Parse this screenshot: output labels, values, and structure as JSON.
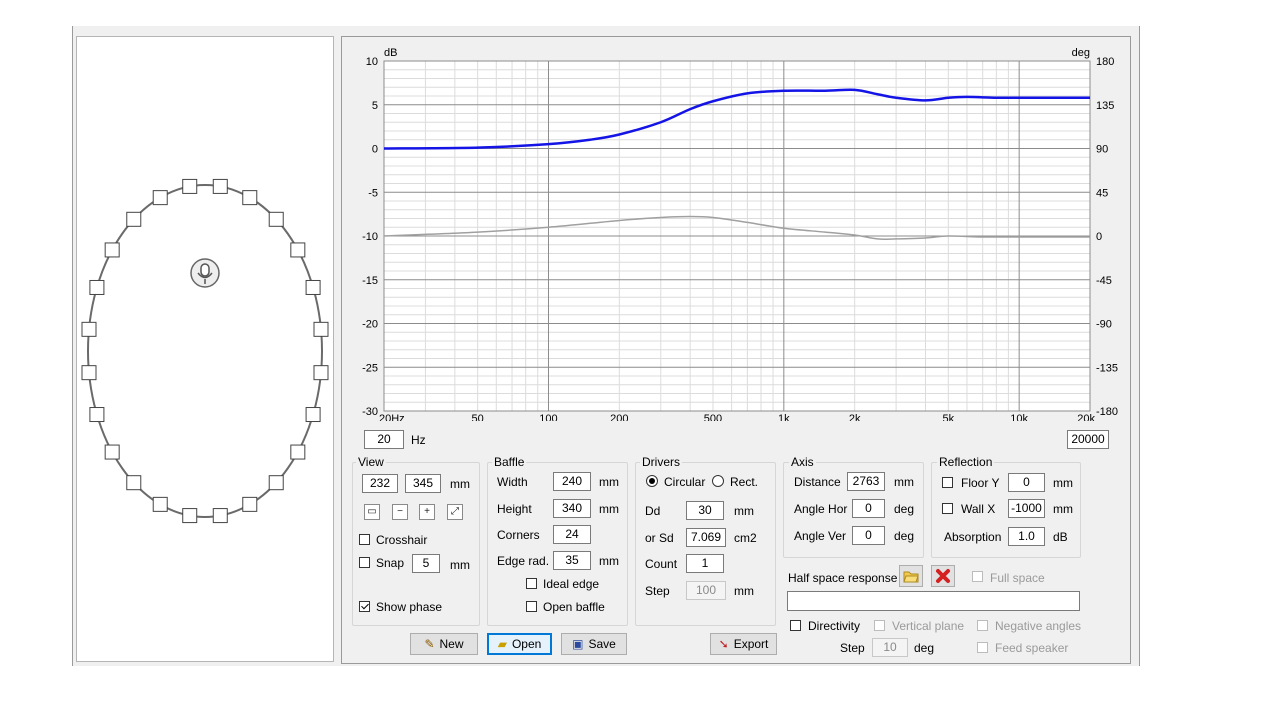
{
  "graph": {
    "left_unit": "dB",
    "right_unit": "deg",
    "y_left": [
      "10",
      "5",
      "0",
      "-5",
      "-10",
      "-15",
      "-20",
      "-25",
      "-30"
    ],
    "y_right": [
      "180",
      "135",
      "90",
      "45",
      "0",
      "-45",
      "-90",
      "-135",
      "-180"
    ],
    "x_ticks": [
      "20Hz",
      "50",
      "100",
      "200",
      "500",
      "1k",
      "2k",
      "5k",
      "10k",
      "20k"
    ],
    "f_min_value": "20",
    "f_min_unit": "Hz",
    "f_max_value": "20000"
  },
  "chart_data": {
    "type": "line",
    "xscale": "log",
    "xlim": [
      20,
      20000
    ],
    "ylim": [
      -30,
      10
    ],
    "y2lim": [
      -180,
      180
    ],
    "grid": true,
    "series": [
      {
        "axis": "left",
        "color": "#1414e6",
        "x": [
          20,
          50,
          100,
          150,
          200,
          300,
          400,
          500,
          700,
          1000,
          1500,
          2000,
          2500,
          3000,
          4000,
          5000,
          6000,
          8000,
          10000,
          15000,
          20000
        ],
        "y": [
          0,
          0.1,
          0.5,
          1.0,
          1.6,
          3.0,
          4.5,
          5.4,
          6.3,
          6.6,
          6.6,
          6.7,
          6.2,
          5.8,
          5.5,
          5.8,
          5.9,
          5.8,
          5.8,
          5.8,
          5.8
        ]
      },
      {
        "axis": "right",
        "color": "#a0a0a0",
        "x": [
          20,
          50,
          100,
          200,
          300,
          400,
          500,
          700,
          1000,
          1500,
          2000,
          2500,
          3000,
          4000,
          5000,
          7000,
          10000,
          20000
        ],
        "y": [
          0,
          4,
          9,
          16,
          19,
          20,
          19,
          14,
          8,
          4,
          1,
          -3,
          -3,
          -2,
          0,
          -1,
          -1,
          -1
        ]
      }
    ]
  },
  "view": {
    "title": "View",
    "w": "232",
    "h": "345",
    "unit": "mm",
    "crosshair": "Crosshair",
    "snap": "Snap",
    "snap_val": "5",
    "snap_unit": "mm",
    "show_phase": "Show phase"
  },
  "baffle": {
    "title": "Baffle",
    "width_label": "Width",
    "width": "240",
    "height_label": "Height",
    "height": "340",
    "corners_label": "Corners",
    "corners": "24",
    "edge_label": "Edge rad.",
    "edge": "35",
    "unit": "mm",
    "ideal_edge": "Ideal edge",
    "open_baffle": "Open baffle"
  },
  "drivers": {
    "title": "Drivers",
    "circular": "Circular",
    "rect": "Rect.",
    "dd_label": "Dd",
    "dd": "30",
    "dd_unit": "mm",
    "sd_label": "or Sd",
    "sd": "7.069",
    "sd_unit": "cm2",
    "count_label": "Count",
    "count": "1",
    "step_label": "Step",
    "step": "100",
    "step_unit": "mm"
  },
  "axis": {
    "title": "Axis",
    "distance_label": "Distance",
    "distance": "2763",
    "distance_unit": "mm",
    "hor_label": "Angle Hor",
    "hor": "0",
    "ver_label": "Angle Ver",
    "ver": "0",
    "deg": "deg"
  },
  "reflection": {
    "title": "Reflection",
    "floor_label": "Floor Y",
    "floor": "0",
    "wall_label": "Wall  X",
    "wall": "-1000",
    "mm": "mm",
    "abs_label": "Absorption",
    "abs": "1.0",
    "abs_unit": "dB"
  },
  "half_space": {
    "label": "Half space response",
    "full_space": "Full space",
    "path": ""
  },
  "directivity": {
    "label": "Directivity",
    "vertical": "Vertical plane",
    "negative": "Negative angles",
    "step_label": "Step",
    "step": "10",
    "deg": "deg",
    "feed": "Feed speaker"
  },
  "buttons": {
    "new": "New",
    "open": "Open",
    "save": "Save",
    "export": "Export"
  }
}
